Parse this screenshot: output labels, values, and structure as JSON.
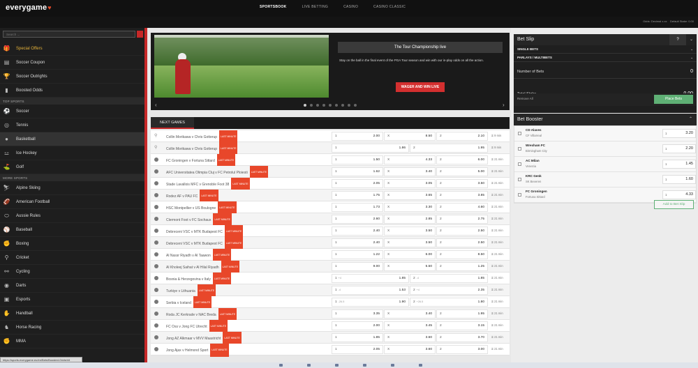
{
  "header": {
    "logo": "everygame",
    "nav": [
      "SPORTSBOOK",
      "LIVE BETTING",
      "CASINO",
      "CASINO CLASSIC"
    ],
    "active_nav": "SPORTSBOOK",
    "odds_format": "Odds: Decimal x.xx",
    "default_stake": "Default Stake: 0.00"
  },
  "sidebar": {
    "search_placeholder": "Search ...",
    "top_items": [
      {
        "label": "Special Offers",
        "icon": "gift-icon",
        "glyph": "🎁"
      },
      {
        "label": "Soccer Coupon",
        "icon": "coupon-icon",
        "glyph": "▤"
      },
      {
        "label": "Soccer Outrights",
        "icon": "trophy-icon",
        "glyph": "🏆"
      },
      {
        "label": "Boosted Odds",
        "icon": "chart-icon",
        "glyph": "▮"
      }
    ],
    "top_sports_heading": "TOP SPORTS",
    "top_sports": [
      {
        "label": "Soccer",
        "icon": "soccer-icon",
        "glyph": "⚽"
      },
      {
        "label": "Tennis",
        "icon": "tennis-icon",
        "glyph": "◎"
      },
      {
        "label": "Basketball",
        "icon": "basketball-icon",
        "glyph": "●"
      },
      {
        "label": "Ice Hockey",
        "icon": "hockey-icon",
        "glyph": "⚍"
      },
      {
        "label": "Golf",
        "icon": "golf-icon",
        "glyph": "⛳"
      }
    ],
    "more_sports_heading": "MORE SPORTS",
    "more_sports": [
      {
        "label": "Alpine Skiing",
        "icon": "skiing-icon",
        "glyph": "⛷"
      },
      {
        "label": "American Football",
        "icon": "football-icon",
        "glyph": "🏈"
      },
      {
        "label": "Aussie Rules",
        "icon": "aussie-rules-icon",
        "glyph": "⬭"
      },
      {
        "label": "Baseball",
        "icon": "baseball-icon",
        "glyph": "⚾"
      },
      {
        "label": "Boxing",
        "icon": "boxing-icon",
        "glyph": "✊"
      },
      {
        "label": "Cricket",
        "icon": "cricket-icon",
        "glyph": "⚲"
      },
      {
        "label": "Cycling",
        "icon": "cycling-icon",
        "glyph": "⚯"
      },
      {
        "label": "Darts",
        "icon": "darts-icon",
        "glyph": "◉"
      },
      {
        "label": "Esports",
        "icon": "esports-icon",
        "glyph": "▣"
      },
      {
        "label": "Handball",
        "icon": "handball-icon",
        "glyph": "✋"
      },
      {
        "label": "Horse Racing",
        "icon": "horse-icon",
        "glyph": "♞"
      },
      {
        "label": "MMA",
        "icon": "mma-icon",
        "glyph": "✊"
      }
    ],
    "status_url": "https://sports.everygame.eu/en/Bets/Boosted-Odds/44"
  },
  "banner": {
    "title": "The Tour Championship live",
    "description": "Stay on the ball in the final event of the PGA Tour season and win with our in-play odds on all the action.",
    "button": "WAGER AND WIN LIVE",
    "prev": "‹",
    "next": "›",
    "dots": 9,
    "active_dot": 0
  },
  "next_games": {
    "tab": "NEXT GAMES",
    "badge": "LAST MINUTE",
    "rows": [
      {
        "icon": "golf-pin-icon",
        "name": "Collin Morikawa v Chris Gotterup",
        "o1": [
          "1",
          "2.00"
        ],
        "oX": [
          "X",
          "8.50"
        ],
        "o2": [
          "2",
          "2.10"
        ],
        "time": "9 min",
        "three": true
      },
      {
        "icon": "golf-pin-icon",
        "name": "Collin Morikawa v Chris Gotterup",
        "o1": [
          "1",
          "1.86"
        ],
        "o2": [
          "2",
          "1.95"
        ],
        "time": "9 min",
        "three": false
      },
      {
        "icon": "soccer-ball-icon",
        "name": "FC Groningen v Fortuna Sittard",
        "o1": [
          "1",
          "1.50"
        ],
        "oX": [
          "X",
          "4.33"
        ],
        "o2": [
          "2",
          "6.00"
        ],
        "time": "21 min",
        "three": true
      },
      {
        "icon": "soccer-ball-icon",
        "name": "AFC Universitatea Olimpia Cluj v FC Petrolul Ploiesti",
        "o1": [
          "1",
          "1.62"
        ],
        "oX": [
          "X",
          "3.40"
        ],
        "o2": [
          "2",
          "5.00"
        ],
        "time": "21 min",
        "three": true
      },
      {
        "icon": "soccer-ball-icon",
        "name": "Stade Lavallois MFC v Grenoble Foot 38",
        "o1": [
          "1",
          "2.05"
        ],
        "oX": [
          "X",
          "3.05"
        ],
        "o2": [
          "2",
          "3.50"
        ],
        "time": "21 min",
        "three": true
      },
      {
        "icon": "soccer-ball-icon",
        "name": "Rodez AF v PAU FC",
        "o1": [
          "1",
          "1.75"
        ],
        "oX": [
          "X",
          "3.65"
        ],
        "o2": [
          "2",
          "3.85"
        ],
        "time": "21 min",
        "three": true
      },
      {
        "icon": "soccer-ball-icon",
        "name": "HSC Montpellier v US Boulogne",
        "o1": [
          "1",
          "1.73"
        ],
        "oX": [
          "X",
          "3.30"
        ],
        "o2": [
          "2",
          "4.60"
        ],
        "time": "21 min",
        "three": true
      },
      {
        "icon": "soccer-ball-icon",
        "name": "Clermont Foot v FC Sochaux",
        "o1": [
          "1",
          "2.60"
        ],
        "oX": [
          "X",
          "2.85"
        ],
        "o2": [
          "2",
          "2.75"
        ],
        "time": "21 min",
        "three": true
      },
      {
        "icon": "soccer-ball-icon",
        "name": "Debreceni VSC v MTK Budapest FC",
        "o1": [
          "1",
          "2.40"
        ],
        "oX": [
          "X",
          "3.50"
        ],
        "o2": [
          "2",
          "2.50"
        ],
        "time": "21 min",
        "three": true
      },
      {
        "icon": "soccer-ball-icon",
        "name": "Debreceni VSC v MTK Budapest FC",
        "o1": [
          "1",
          "2.40"
        ],
        "oX": [
          "X",
          "3.50"
        ],
        "o2": [
          "2",
          "2.50"
        ],
        "time": "21 min",
        "three": true
      },
      {
        "icon": "soccer-ball-icon",
        "name": "Al Nassr Riyadh v Al Taawon",
        "o1": [
          "1",
          "1.22"
        ],
        "oX": [
          "X",
          "6.00"
        ],
        "o2": [
          "2",
          "8.50"
        ],
        "time": "21 min",
        "three": true
      },
      {
        "icon": "soccer-ball-icon",
        "name": "Al Kholeej Saihat v Al Hilal Riyadh",
        "o1": [
          "1",
          "9.00"
        ],
        "oX": [
          "X",
          "5.50"
        ],
        "o2": [
          "2",
          "1.25"
        ],
        "time": "21 min",
        "three": true
      },
      {
        "icon": "basketball-ball-icon",
        "name": "Bosnia & Herzegovina v Italy",
        "o1": [
          "1",
          "1.85"
        ],
        "h1": "+4",
        "o2": [
          "2",
          "1.85"
        ],
        "h2": "-4",
        "time": "21 min",
        "three": false
      },
      {
        "icon": "basketball-ball-icon",
        "name": "Turkiye v Lithuania",
        "o1": [
          "1",
          "1.53"
        ],
        "h1": "-4",
        "o2": [
          "2",
          "2.35"
        ],
        "h2": "+4",
        "time": "21 min",
        "three": false
      },
      {
        "icon": "basketball-ball-icon",
        "name": "Serbia v Iceland",
        "o1": [
          "1",
          "1.90"
        ],
        "h1": "-26.5",
        "o2": [
          "2",
          "1.80"
        ],
        "h2": "+26.5",
        "time": "21 min",
        "three": false
      },
      {
        "icon": "soccer-ball-icon",
        "name": "Roda JC Kerkrade v NAC Breda",
        "o1": [
          "1",
          "3.35"
        ],
        "oX": [
          "X",
          "3.40"
        ],
        "o2": [
          "2",
          "1.95"
        ],
        "time": "21 min",
        "three": true
      },
      {
        "icon": "soccer-ball-icon",
        "name": "FC Oss v Jong FC Utrecht",
        "o1": [
          "1",
          "2.00"
        ],
        "oX": [
          "X",
          "3.45"
        ],
        "o2": [
          "2",
          "3.15"
        ],
        "time": "21 min",
        "three": true
      },
      {
        "icon": "soccer-ball-icon",
        "name": "Jong AZ Alkmaar v MVV Maastricht",
        "o1": [
          "1",
          "1.85"
        ],
        "oX": [
          "X",
          "3.60"
        ],
        "o2": [
          "2",
          "3.70"
        ],
        "time": "21 min",
        "three": true
      },
      {
        "icon": "soccer-ball-icon",
        "name": "Jong Ajax v Helmond Sport",
        "o1": [
          "1",
          "2.05"
        ],
        "oX": [
          "X",
          "3.60"
        ],
        "o2": [
          "2",
          "3.00"
        ],
        "time": "21 min",
        "three": true
      }
    ]
  },
  "bet_slip": {
    "title": "Bet Slip",
    "help": "?",
    "close": "⌄",
    "tabs": [
      "SINGLE BETS",
      "PARLAYS / MULTIBETS"
    ],
    "number_of_bets_label": "Number of Bets",
    "number_of_bets": "0",
    "total_stake_label": "Total Stake",
    "total_stake": "0.00",
    "remove_all": "Remove All",
    "place_bets": "Place Bets"
  },
  "bet_booster": {
    "title": "Bet Booster",
    "items": [
      {
        "team": "CD Alaves",
        "opp": "CF Villarreal",
        "sel": "1",
        "odd": "3.20"
      },
      {
        "team": "Wrexham FC",
        "opp": "Birmingham City",
        "sel": "1",
        "odd": "2.20"
      },
      {
        "team": "AC Milan",
        "opp": "Venezia",
        "sel": "1",
        "odd": "1.45"
      },
      {
        "team": "KRC Genk",
        "opp": "SK Beveren",
        "sel": "1",
        "odd": "1.60"
      },
      {
        "team": "FC Groningen",
        "opp": "Fortuna Sittard",
        "sel": "1",
        "odd": "4.33"
      }
    ],
    "add_button": "Add to Bet Slip"
  },
  "colors": {
    "accent_red": "#c62828",
    "badge_orange": "#e8472a",
    "place_green": "#5fb075"
  }
}
